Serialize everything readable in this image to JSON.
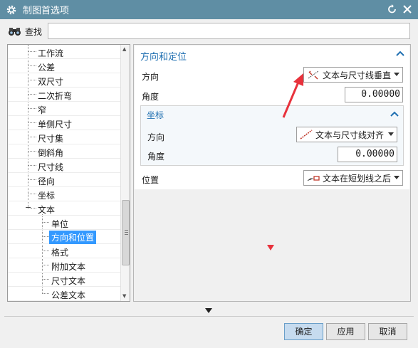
{
  "window": {
    "title": "制图首选项"
  },
  "search": {
    "label": "查找",
    "value": ""
  },
  "tree": {
    "items": [
      {
        "label": "工作流",
        "level": 1
      },
      {
        "label": "公差",
        "level": 1
      },
      {
        "label": "双尺寸",
        "level": 1
      },
      {
        "label": "二次折弯",
        "level": 1
      },
      {
        "label": "窄",
        "level": 1
      },
      {
        "label": "单侧尺寸",
        "level": 1
      },
      {
        "label": "尺寸集",
        "level": 1
      },
      {
        "label": "倒斜角",
        "level": 1
      },
      {
        "label": "尺寸线",
        "level": 1
      },
      {
        "label": "径向",
        "level": 1
      },
      {
        "label": "坐标",
        "level": 1
      },
      {
        "label": "文本",
        "level": 1,
        "expanded": true
      },
      {
        "label": "单位",
        "level": 2
      },
      {
        "label": "方向和位置",
        "level": 2,
        "selected": true
      },
      {
        "label": "格式",
        "level": 2
      },
      {
        "label": "附加文本",
        "level": 2
      },
      {
        "label": "尺寸文本",
        "level": 2
      },
      {
        "label": "公差文本",
        "level": 2
      }
    ]
  },
  "panel": {
    "section_title": "方向和定位",
    "orientation_label": "方向",
    "orientation_value": "文本与尺寸线垂直",
    "angle_label": "角度",
    "angle_value": "0.00000",
    "coord": {
      "title": "坐标",
      "orientation_label": "方向",
      "orientation_value": "文本与尺寸线对齐",
      "angle_label": "角度",
      "angle_value": "0.00000"
    },
    "position_label": "位置",
    "position_value": "文本在短划线之后"
  },
  "buttons": {
    "ok": "确定",
    "apply": "应用",
    "cancel": "取消"
  },
  "colors": {
    "titlebar": "#5f8ea4",
    "accent": "#1f6fb1",
    "selection": "#3399ff",
    "annotation": "#e8323c"
  },
  "icons": [
    "gear-icon",
    "reset-icon",
    "close-icon",
    "binoculars-icon",
    "collapse-icon",
    "expand-icon",
    "dropdown-icon"
  ]
}
